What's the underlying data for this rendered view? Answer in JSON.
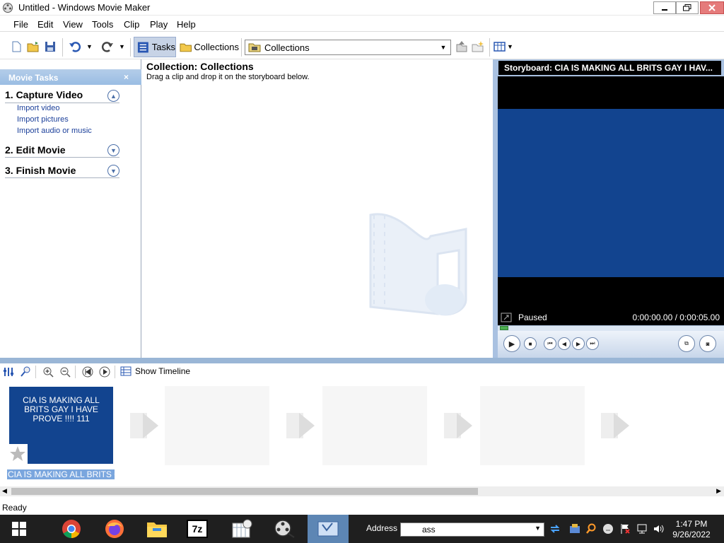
{
  "window": {
    "title": "Untitled - Windows Movie Maker"
  },
  "menu": [
    "File",
    "Edit",
    "View",
    "Tools",
    "Clip",
    "Play",
    "Help"
  ],
  "toolbar": {
    "tasks_label": "Tasks",
    "collections_label": "Collections",
    "collection_select": "Collections"
  },
  "movie_tasks": {
    "header": "Movie Tasks",
    "close": "×",
    "sections": [
      {
        "title": "1. Capture Video",
        "links": [
          "Import video",
          "Import pictures",
          "Import audio or music"
        ],
        "expanded": true
      },
      {
        "title": "2. Edit Movie",
        "expanded": false
      },
      {
        "title": "3. Finish Movie",
        "expanded": false
      }
    ]
  },
  "collection": {
    "title": "Collection: Collections",
    "subtitle": "Drag a clip and drop it on the storyboard below."
  },
  "preview": {
    "title": "Storyboard: CIA IS MAKING ALL BRITS GAY I HAV...",
    "status": "Paused",
    "time": "0:00:00.00 / 0:00:05.00"
  },
  "storyboard": {
    "show_timeline": "Show Timeline",
    "clip_text": "CIA IS MAKING ALL BRITS GAY I HAVE PROVE !!!! 111",
    "clip_label": "CIA IS MAKING ALL BRITS G..."
  },
  "statusbar": {
    "text": "Ready"
  },
  "taskbar": {
    "address_label": "Address",
    "address_value": "ass",
    "time": "1:47 PM",
    "date": "9/26/2022"
  },
  "colors": {
    "storyboard_blue": "#12448f",
    "pane_blue": "#a9c1e1",
    "taskbar": "#1f1f1f"
  }
}
